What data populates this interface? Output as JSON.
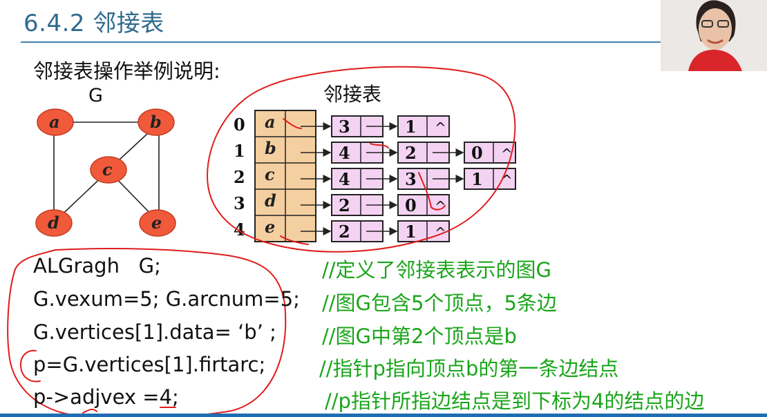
{
  "slide": {
    "title": "6.4.2 邻接表",
    "subtitle": "邻接表操作举例说明:"
  },
  "graph": {
    "name": "G",
    "vertices": [
      "a",
      "b",
      "c",
      "d",
      "e"
    ],
    "edges": [
      [
        "a",
        "b"
      ],
      [
        "a",
        "d"
      ],
      [
        "b",
        "c"
      ],
      [
        "b",
        "e"
      ],
      [
        "c",
        "d"
      ],
      [
        "c",
        "e"
      ]
    ]
  },
  "adjacency_list": {
    "label": "邻接表",
    "null_symbol": "^",
    "rows": [
      {
        "index": "0",
        "vertex": "a",
        "nodes": [
          "3",
          "1"
        ]
      },
      {
        "index": "1",
        "vertex": "b",
        "nodes": [
          "4",
          "2",
          "0"
        ]
      },
      {
        "index": "2",
        "vertex": "c",
        "nodes": [
          "4",
          "3",
          "1"
        ]
      },
      {
        "index": "3",
        "vertex": "d",
        "nodes": [
          "2",
          "0"
        ]
      },
      {
        "index": "4",
        "vertex": "e",
        "nodes": [
          "2",
          "1"
        ]
      }
    ]
  },
  "code_lines": [
    {
      "code": "ALGragh   G;",
      "comment": "//定义了邻接表表示的图G"
    },
    {
      "code": "G.vexum=5; G.arcnum=5;",
      "comment": "//图G包含5个顶点，5条边"
    },
    {
      "code": "G.vertices[1].data= ‘b’ ;",
      "comment": "//图G中第2个顶点是b"
    },
    {
      "code": "p=G.vertices[1].firtarc;",
      "comment": "//指针p指向顶点b的第一条边结点"
    },
    {
      "code": "p->adjvex =4;",
      "comment": "//p指针所指边结点是到下标为4的结点的边"
    }
  ],
  "colors": {
    "title": "#2e6b8f",
    "vertex_fill": "#f05a3a",
    "head_fill": "#f4cfa0",
    "node_fill": "#f4d2f2",
    "comment": "#1aa51a",
    "annotation": "#e01b1b"
  }
}
